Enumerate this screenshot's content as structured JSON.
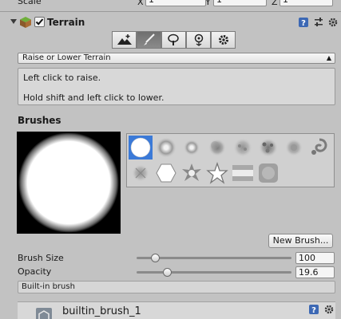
{
  "transform": {
    "scale_label": "Scale",
    "x_label": "X",
    "x_value": "1",
    "y_label": "Y",
    "y_value": "1",
    "z_label": "Z",
    "z_value": "1"
  },
  "component": {
    "title": "Terrain",
    "enabled": true,
    "icons": [
      "book-icon",
      "sliders-icon",
      "gear-icon"
    ]
  },
  "toolbar": {
    "tools": [
      {
        "name": "raise-terrain-tool",
        "icon": "mountain-arrow-icon",
        "active": false
      },
      {
        "name": "paint-tool",
        "icon": "brush-icon",
        "active": true
      },
      {
        "name": "place-trees-tool",
        "icon": "tree-icon",
        "active": false
      },
      {
        "name": "paint-details-tool",
        "icon": "flower-icon",
        "active": false
      },
      {
        "name": "settings-tool",
        "icon": "gear-icon",
        "active": false
      }
    ]
  },
  "mode_dropdown": {
    "value": "Raise or Lower Terrain"
  },
  "help": {
    "line1": "Left click to raise.",
    "line2": "Hold shift and left click to lower."
  },
  "brushes": {
    "heading": "Brushes",
    "new_brush_label": "New Brush...",
    "selected_index": 0,
    "items": [
      "hard-circle",
      "soft-circle",
      "small-soft-circle",
      "cloud-blob",
      "noise-soft",
      "noise-blob",
      "splat-soft",
      "swirl",
      "grain-soft",
      "hexagon",
      "star-burst",
      "star-outline",
      "stripe-noise",
      "square-noise"
    ]
  },
  "brush_size": {
    "label": "Brush Size",
    "value": "100",
    "level": 0.12
  },
  "opacity": {
    "label": "Opacity",
    "value": "19.6",
    "level": 0.2
  },
  "brush_info": {
    "label": "Built-in brush"
  },
  "object_row": {
    "name": "builtin_brush_1"
  }
}
